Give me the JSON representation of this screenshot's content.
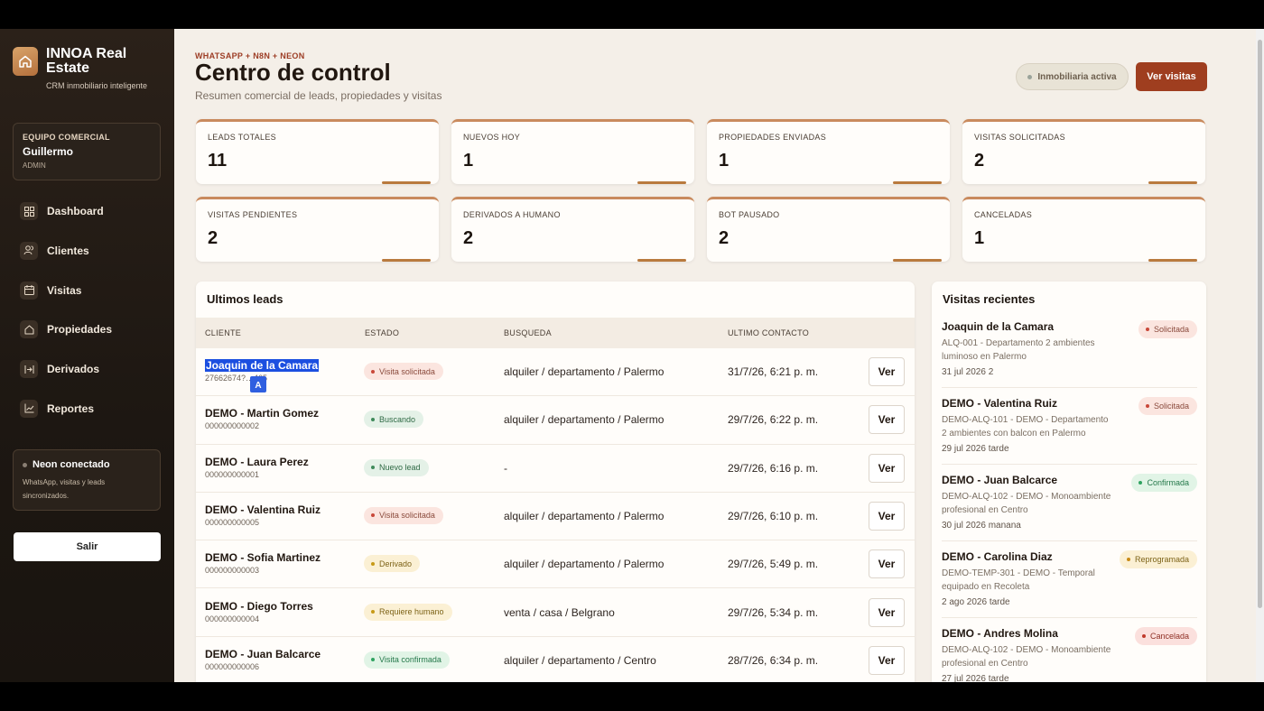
{
  "brand": {
    "title": "INNOA Real Estate",
    "subtitle": "CRM inmobiliario inteligente",
    "icon": "house-icon"
  },
  "team": {
    "label": "EQUIPO COMERCIAL",
    "name": "Guillermo",
    "role": "ADMIN"
  },
  "nav": [
    {
      "label": "Dashboard",
      "icon": "grid-icon"
    },
    {
      "label": "Clientes",
      "icon": "users-icon"
    },
    {
      "label": "Visitas",
      "icon": "calendar-icon"
    },
    {
      "label": "Propiedades",
      "icon": "house-icon"
    },
    {
      "label": "Derivados",
      "icon": "transfer-icon"
    },
    {
      "label": "Reportes",
      "icon": "chart-icon"
    }
  ],
  "neon": {
    "title": "Neon conectado",
    "desc": "WhatsApp, visitas y leads sincronizados."
  },
  "logout": "Salir",
  "header": {
    "eyebrow": "WHATSAPP + N8N + NEON",
    "title": "Centro de control",
    "subtitle": "Resumen comercial de leads, propiedades y visitas",
    "status": "Inmobiliaria activa",
    "action": "Ver visitas"
  },
  "stats": [
    {
      "label": "LEADS TOTALES",
      "value": "11"
    },
    {
      "label": "NUEVOS HOY",
      "value": "1"
    },
    {
      "label": "PROPIEDADES ENVIADAS",
      "value": "1"
    },
    {
      "label": "VISITAS SOLICITADAS",
      "value": "2"
    },
    {
      "label": "VISITAS PENDIENTES",
      "value": "2"
    },
    {
      "label": "DERIVADOS A HUMANO",
      "value": "2"
    },
    {
      "label": "BOT PAUSADO",
      "value": "2"
    },
    {
      "label": "CANCELADAS",
      "value": "1"
    }
  ],
  "leads": {
    "title": "Ultimos leads",
    "columns": {
      "cliente": "CLIENTE",
      "estado": "ESTADO",
      "busqueda": "BUSQUEDA",
      "contacto": "ULTIMO CONTACTO"
    },
    "ver_label": "Ver",
    "rows": [
      {
        "name": "Joaquin de la Camara",
        "phone": "27662674?…465",
        "status": "Visita solicitada",
        "busqueda": "alquiler / departamento / Palermo",
        "contacto": "31/7/26, 6:21 p. m."
      },
      {
        "name": "DEMO - Martin Gomez",
        "phone": "000000000002",
        "status": "Buscando",
        "busqueda": "alquiler / departamento / Palermo",
        "contacto": "29/7/26, 6:22 p. m."
      },
      {
        "name": "DEMO - Laura Perez",
        "phone": "000000000001",
        "status": "Nuevo lead",
        "busqueda": "-",
        "contacto": "29/7/26, 6:16 p. m."
      },
      {
        "name": "DEMO - Valentina Ruiz",
        "phone": "000000000005",
        "status": "Visita solicitada",
        "busqueda": "alquiler / departamento / Palermo",
        "contacto": "29/7/26, 6:10 p. m."
      },
      {
        "name": "DEMO - Sofia Martinez",
        "phone": "000000000003",
        "status": "Derivado",
        "busqueda": "alquiler / departamento / Palermo",
        "contacto": "29/7/26, 5:49 p. m."
      },
      {
        "name": "DEMO - Diego Torres",
        "phone": "000000000004",
        "status": "Requiere humano",
        "busqueda": "venta / casa / Belgrano",
        "contacto": "29/7/26, 5:34 p. m."
      },
      {
        "name": "DEMO - Juan Balcarce",
        "phone": "000000000006",
        "status": "Visita confirmada",
        "busqueda": "alquiler / departamento / Centro",
        "contacto": "28/7/26, 6:34 p. m."
      }
    ]
  },
  "visits": {
    "title": "Visitas recientes",
    "items": [
      {
        "name": "Joaquin de la Camara",
        "desc": "ALQ-001 - Departamento 2 ambientes luminoso en Palermo",
        "date": "31 jul 2026 2",
        "status": "Solicitada"
      },
      {
        "name": "DEMO - Valentina Ruiz",
        "desc": "DEMO-ALQ-101 - DEMO - Departamento 2 ambientes con balcon en Palermo",
        "date": "29 jul 2026 tarde",
        "status": "Solicitada"
      },
      {
        "name": "DEMO - Juan Balcarce",
        "desc": "DEMO-ALQ-102 - DEMO - Monoambiente profesional en Centro",
        "date": "30 jul 2026 manana",
        "status": "Confirmada"
      },
      {
        "name": "DEMO - Carolina Diaz",
        "desc": "DEMO-TEMP-301 - DEMO - Temporal equipado en Recoleta",
        "date": "2 ago 2026 tarde",
        "status": "Reprogramada"
      },
      {
        "name": "DEMO - Andres Molina",
        "desc": "DEMO-ALQ-102 - DEMO - Monoambiente profesional en Centro",
        "date": "27 jul 2026 tarde",
        "status": "Cancelada"
      }
    ]
  },
  "colors": {
    "accent": "#9f3e1f",
    "status_requested": "#c9483a",
    "status_searching": "#3f8a5a",
    "status_derived": "#c79a17",
    "status_confirmed": "#2fa360",
    "status_rescheduled": "#c98a16",
    "status_cancelled": "#c0392b"
  }
}
